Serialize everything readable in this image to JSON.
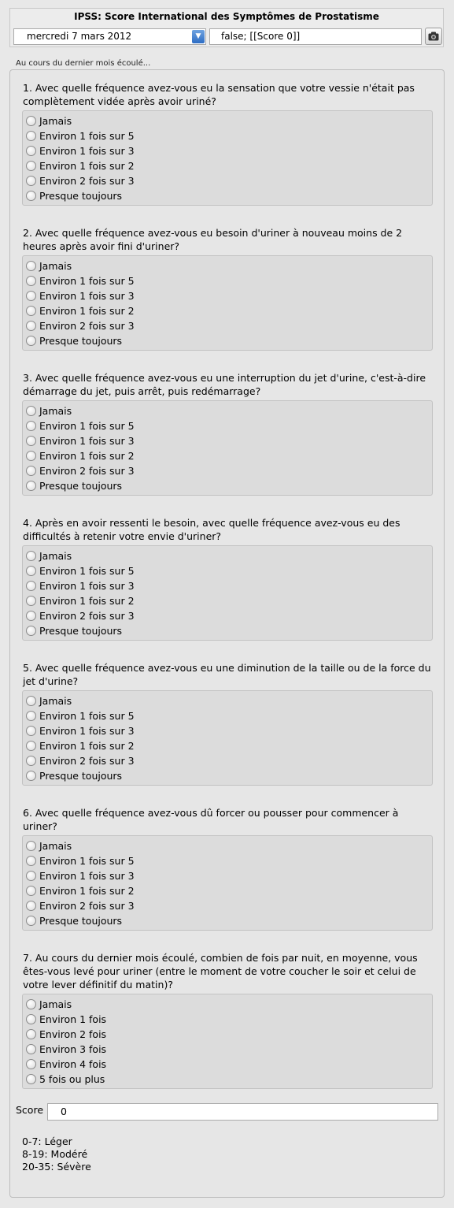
{
  "header": {
    "title": "IPSS: Score International des Symptômes de Prostatisme",
    "date_value": "mercredi 7 mars 2012",
    "result_value": "false; [[Score 0]]",
    "camera_icon": "camera-icon"
  },
  "intro": "Au cours du dernier mois écoulé...",
  "questions": [
    {
      "text": "1. Avec quelle fréquence avez-vous eu la sensation que votre vessie n'était pas complètement vidée après avoir uriné?",
      "options": [
        "Jamais",
        "Environ 1 fois sur 5",
        "Environ 1 fois sur 3",
        "Environ 1 fois sur 2",
        "Environ 2 fois sur 3",
        "Presque toujours"
      ]
    },
    {
      "text": "2. Avec quelle fréquence avez-vous eu besoin d'uriner à nouveau moins de 2 heures après avoir fini d'uriner?",
      "options": [
        "Jamais",
        "Environ 1 fois sur 5",
        "Environ 1 fois sur 3",
        "Environ 1 fois sur 2",
        "Environ 2 fois sur 3",
        "Presque toujours"
      ]
    },
    {
      "text": "3. Avec quelle fréquence avez-vous eu une interruption du jet d'urine, c'est-à-dire démarrage du jet, puis arrêt, puis redémarrage?",
      "options": [
        "Jamais",
        "Environ 1 fois sur 5",
        "Environ 1 fois sur 3",
        "Environ 1 fois sur 2",
        "Environ 2 fois sur 3",
        "Presque toujours"
      ]
    },
    {
      "text": "4. Après en avoir ressenti le besoin, avec quelle fréquence avez-vous eu des difficultés à retenir votre envie d'uriner?",
      "options": [
        "Jamais",
        "Environ 1 fois sur 5",
        "Environ 1 fois sur 3",
        "Environ 1 fois sur 2",
        "Environ 2 fois sur 3",
        "Presque toujours"
      ]
    },
    {
      "text": "5. Avec quelle fréquence avez-vous eu une diminution de la taille ou de la force du jet d'urine?",
      "options": [
        "Jamais",
        "Environ 1 fois sur 5",
        "Environ 1 fois sur 3",
        "Environ 1 fois sur 2",
        "Environ 2 fois sur 3",
        "Presque toujours"
      ]
    },
    {
      "text": "6. Avec quelle fréquence avez-vous dû forcer ou pousser pour commencer à uriner?",
      "options": [
        "Jamais",
        "Environ 1 fois sur 5",
        "Environ 1 fois sur 3",
        "Environ 1 fois sur 2",
        "Environ 2 fois sur 3",
        "Presque toujours"
      ]
    },
    {
      "text": "7. Au cours du dernier mois écoulé, combien de fois par nuit, en moyenne, vous êtes-vous levé pour uriner (entre le moment de votre coucher le soir et celui de votre lever définitif du matin)?",
      "options": [
        "Jamais",
        "Environ 1 fois",
        "Environ 2 fois",
        "Environ 3 fois",
        "Environ 4 fois",
        "5 fois ou plus"
      ]
    }
  ],
  "score": {
    "label": "Score",
    "value": "0"
  },
  "legend": [
    "0-7: Léger",
    "8-19: Modéré",
    "20-35: Sévère"
  ]
}
